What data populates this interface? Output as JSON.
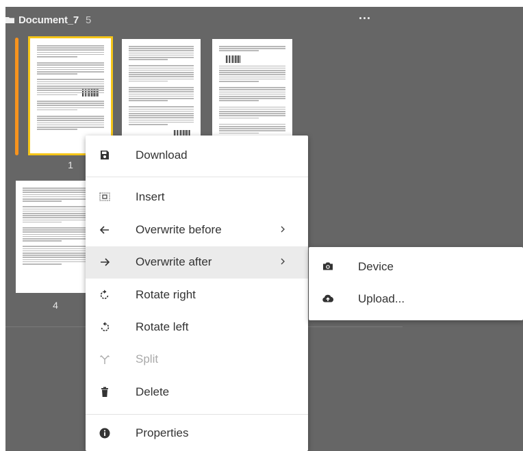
{
  "document": {
    "title": "Document_7",
    "page_count": "5"
  },
  "icons": {
    "folder": "folder-icon",
    "more": "more-horizontal-icon"
  },
  "colors": {
    "workspace_bg": "#666666",
    "selection_bar": "#f7931d",
    "selection_outline": "#f5c518",
    "menu_bg": "#ffffff",
    "menu_highlight": "#ebebeb"
  },
  "pages": [
    {
      "label": "1",
      "selected": true
    },
    {
      "label": "",
      "selected": false
    },
    {
      "label": "",
      "selected": false
    },
    {
      "label": "4",
      "selected": false
    }
  ],
  "context_menu": {
    "items": [
      {
        "id": "download",
        "label": "Download",
        "icon": "save-icon"
      },
      {
        "id": "insert",
        "label": "Insert",
        "icon": "insert-page-icon"
      },
      {
        "id": "overwrite_before",
        "label": "Overwrite before",
        "icon": "arrow-left-icon",
        "has_submenu": true
      },
      {
        "id": "overwrite_after",
        "label": "Overwrite after",
        "icon": "arrow-right-icon",
        "has_submenu": true,
        "highlighted": true
      },
      {
        "id": "rotate_right",
        "label": "Rotate right",
        "icon": "rotate-right-icon"
      },
      {
        "id": "rotate_left",
        "label": "Rotate left",
        "icon": "rotate-left-icon"
      },
      {
        "id": "split",
        "label": "Split",
        "icon": "split-icon",
        "disabled": true
      },
      {
        "id": "delete",
        "label": "Delete",
        "icon": "trash-icon"
      },
      {
        "id": "properties",
        "label": "Properties",
        "icon": "info-icon"
      }
    ]
  },
  "submenu": {
    "items": [
      {
        "id": "device",
        "label": "Device",
        "icon": "camera-icon"
      },
      {
        "id": "upload",
        "label": "Upload...",
        "icon": "cloud-upload-icon"
      }
    ]
  }
}
